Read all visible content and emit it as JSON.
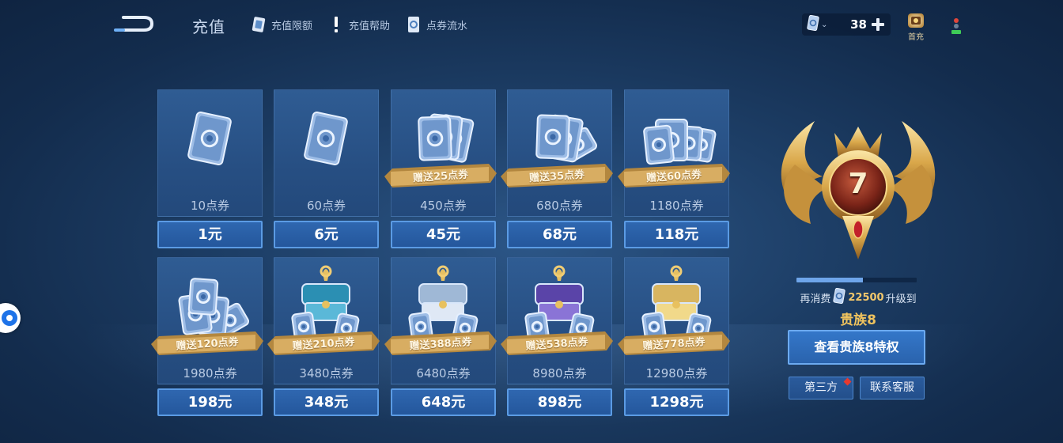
{
  "header": {
    "title": "充值",
    "links": [
      {
        "label": "充值限额",
        "icon": "card-limit-icon"
      },
      {
        "label": "充值帮助",
        "icon": "exclamation-icon"
      },
      {
        "label": "点券流水",
        "icon": "coupon-history-icon"
      }
    ]
  },
  "currency": {
    "amount": "38",
    "icon": "coupon-card-icon"
  },
  "first_charge": {
    "label": "首充"
  },
  "packs": [
    {
      "amount": "10点券",
      "price": "1元",
      "bonus": ""
    },
    {
      "amount": "60点券",
      "price": "6元",
      "bonus": ""
    },
    {
      "amount": "450点券",
      "price": "45元",
      "bonus": "赠送25点券"
    },
    {
      "amount": "680点券",
      "price": "68元",
      "bonus": "赠送35点券"
    },
    {
      "amount": "1180点券",
      "price": "118元",
      "bonus": "赠送60点券"
    },
    {
      "amount": "1980点券",
      "price": "198元",
      "bonus": "赠送120点券"
    },
    {
      "amount": "3480点券",
      "price": "348元",
      "bonus": "赠送210点券"
    },
    {
      "amount": "6480点券",
      "price": "648元",
      "bonus": "赠送388点券"
    },
    {
      "amount": "8980点券",
      "price": "898元",
      "bonus": "赠送538点券"
    },
    {
      "amount": "12980点券",
      "price": "1298元",
      "bonus": "赠送778点券"
    }
  ],
  "vip": {
    "level": "7",
    "progress_fraction": 0.55,
    "upgrade_prefix": "再消费",
    "upgrade_amount": "22500",
    "upgrade_suffix": "升级到",
    "next_level": "贵族8",
    "privilege_button": "查看贵族8特权",
    "third_party_button": "第三方",
    "support_button": "联系客服"
  },
  "colors": {
    "accent_blue": "#5b9be4",
    "gold": "#f0c35e",
    "bonus_red_dot": "#e8392e"
  }
}
